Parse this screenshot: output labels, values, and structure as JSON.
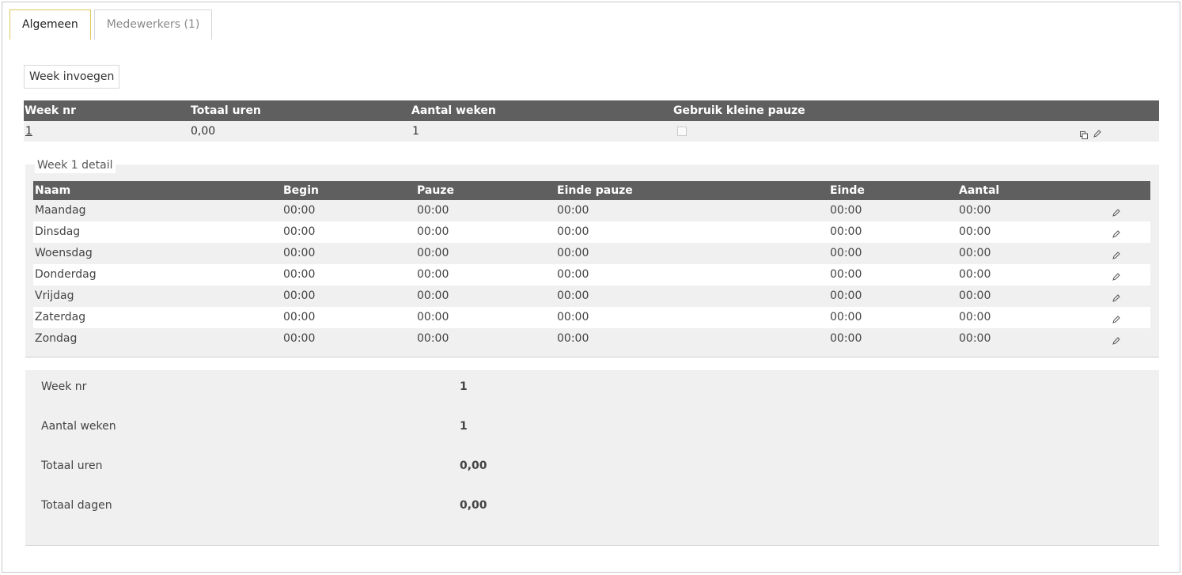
{
  "tabs": [
    {
      "label": "Algemeen"
    },
    {
      "label": "Medewerkers (1)"
    }
  ],
  "toolbar": {
    "insert_week_label": "Week invoegen"
  },
  "week_table": {
    "headers": [
      "Week nr",
      "Totaal uren",
      "Aantal weken",
      "Gebruik kleine pauze"
    ],
    "row": {
      "week_nr": "1",
      "totaal_uren": "0,00",
      "aantal_weken": "1",
      "gebruik_kleine_pauze": false
    }
  },
  "detail": {
    "legend": "Week 1 detail",
    "headers": [
      "Naam",
      "Begin",
      "Pauze",
      "Einde pauze",
      "Einde",
      "Aantal"
    ],
    "rows": [
      {
        "naam": "Maandag",
        "begin": "00:00",
        "pauze": "00:00",
        "einde_pauze": "00:00",
        "einde": "00:00",
        "aantal": "00:00"
      },
      {
        "naam": "Dinsdag",
        "begin": "00:00",
        "pauze": "00:00",
        "einde_pauze": "00:00",
        "einde": "00:00",
        "aantal": "00:00"
      },
      {
        "naam": "Woensdag",
        "begin": "00:00",
        "pauze": "00:00",
        "einde_pauze": "00:00",
        "einde": "00:00",
        "aantal": "00:00"
      },
      {
        "naam": "Donderdag",
        "begin": "00:00",
        "pauze": "00:00",
        "einde_pauze": "00:00",
        "einde": "00:00",
        "aantal": "00:00"
      },
      {
        "naam": "Vrijdag",
        "begin": "00:00",
        "pauze": "00:00",
        "einde_pauze": "00:00",
        "einde": "00:00",
        "aantal": "00:00"
      },
      {
        "naam": "Zaterdag",
        "begin": "00:00",
        "pauze": "00:00",
        "einde_pauze": "00:00",
        "einde": "00:00",
        "aantal": "00:00"
      },
      {
        "naam": "Zondag",
        "begin": "00:00",
        "pauze": "00:00",
        "einde_pauze": "00:00",
        "einde": "00:00",
        "aantal": "00:00"
      }
    ]
  },
  "summary": {
    "week_nr_label": "Week nr",
    "week_nr_value": "1",
    "aantal_weken_label": "Aantal weken",
    "aantal_weken_value": "1",
    "totaal_uren_label": "Totaal uren",
    "totaal_uren_value": "0,00",
    "totaal_dagen_label": "Totaal dagen",
    "totaal_dagen_value": "0,00"
  },
  "icons": {
    "copy": "copy-icon",
    "edit": "pencil-icon"
  },
  "colors": {
    "header_bg": "#5f5f5f",
    "active_tab_border": "#e0c75a",
    "row_bg": "#f0f0f0"
  }
}
